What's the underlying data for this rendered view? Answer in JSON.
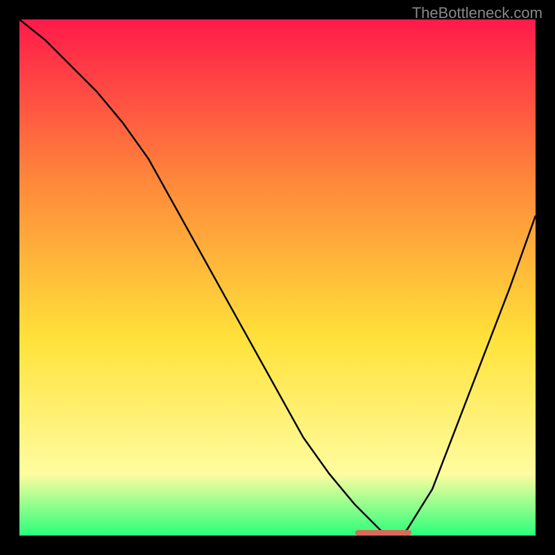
{
  "watermark": "TheBottleneck.com",
  "chart_data": {
    "type": "line",
    "title": "",
    "xlabel": "",
    "ylabel": "",
    "xlim": [
      0,
      100
    ],
    "ylim": [
      0,
      100
    ],
    "gradient_colors": {
      "top": "#ff1a4a",
      "mid1": "#ff8a3a",
      "mid2": "#ffe23a",
      "mid3": "#fffca0",
      "bottom": "#2aff7a"
    },
    "series": [
      {
        "name": "curve",
        "x": [
          0,
          5,
          10,
          15,
          20,
          25,
          30,
          35,
          40,
          45,
          50,
          55,
          60,
          65,
          70,
          72,
          75,
          80,
          85,
          90,
          95,
          100
        ],
        "values": [
          100,
          96,
          91,
          86,
          80,
          73,
          64,
          55,
          46,
          37,
          28,
          19,
          12,
          6,
          1,
          0,
          1,
          9,
          22,
          35,
          48,
          62
        ]
      }
    ],
    "marker": {
      "x_start": 65,
      "x_end": 76,
      "y": 0.5,
      "color": "#d96a5a"
    }
  }
}
